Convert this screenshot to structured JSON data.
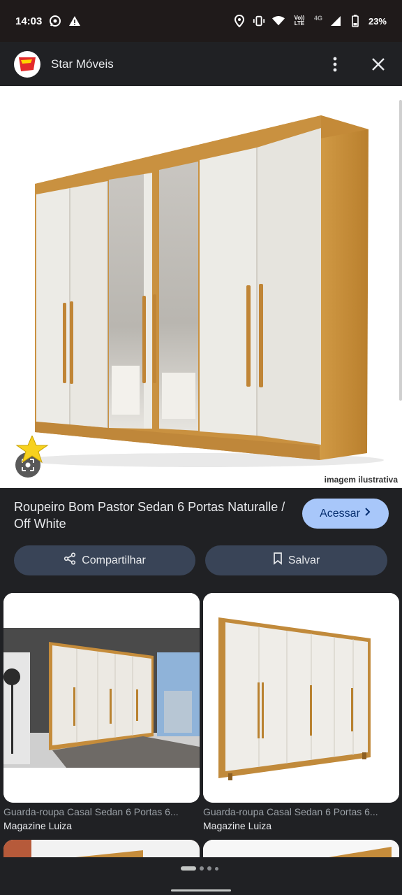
{
  "status_bar": {
    "time": "14:03",
    "network_label": "4G",
    "volte_label": "Vo)) LTE",
    "battery": "23%",
    "icons": [
      "whatsapp-icon",
      "warning-icon",
      "location-icon",
      "vibrate-icon",
      "wifi-icon",
      "signal-icon",
      "battery-icon"
    ]
  },
  "app_bar": {
    "site_name": "Star Móveis",
    "logo_text": "Star",
    "icons": [
      "more-vert-icon",
      "close-icon"
    ]
  },
  "hero": {
    "caption": "imagem ilustrativa"
  },
  "product": {
    "title": "Roupeiro Bom Pastor Sedan 6 Portas Naturalle / Off White",
    "visit_label": "Acessar",
    "share_label": "Compartilhar",
    "save_label": "Salvar"
  },
  "related": [
    {
      "title": "Guarda-roupa Casal Sedan 6 Portas 6...",
      "source": "Magazine Luiza"
    },
    {
      "title": "Guarda-roupa Casal Sedan 6 Portas 6...",
      "source": "Magazine Luiza"
    }
  ],
  "colors": {
    "background": "#202124",
    "accent": "#a8c7fa",
    "pill": "#394457",
    "wood": "#c98f3a",
    "door": "#ece9e2"
  }
}
